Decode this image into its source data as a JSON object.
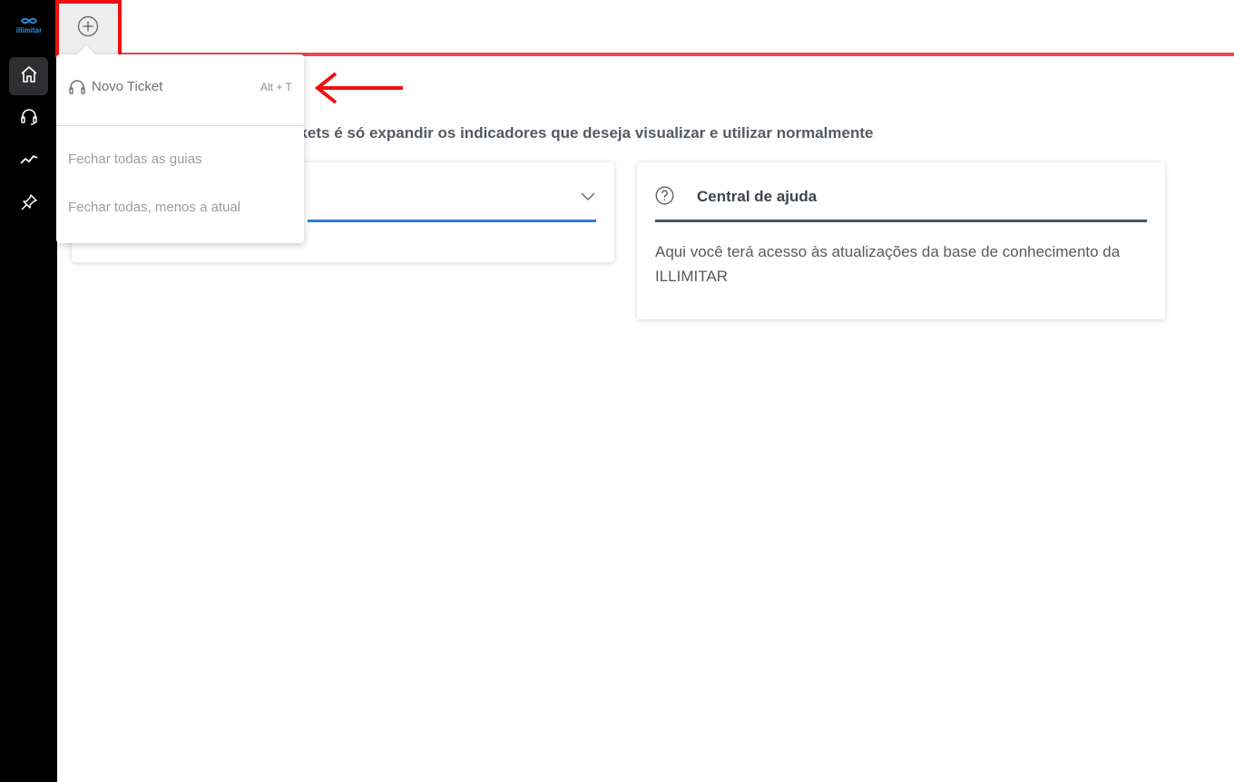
{
  "sidebar": {
    "logo_text": "illimitar",
    "items": [
      {
        "name": "home-icon",
        "active": true
      },
      {
        "name": "headset-icon",
        "active": false
      },
      {
        "name": "trend-chart-icon",
        "active": false
      },
      {
        "name": "pin-icon",
        "active": false
      }
    ]
  },
  "tabs": {
    "add_tab_icon": "plus-circle-icon"
  },
  "main": {
    "subtitle": "ckets é só expandir os indicadores que deseja visualizar e utilizar normalmente",
    "help_card": {
      "title": "Central de ajuda",
      "body": "Aqui você terá acesso às atualizações da base de conhecimento da ILLIMITAR"
    }
  },
  "dropdown": {
    "new_ticket_label": "Novo Ticket",
    "new_ticket_shortcut": "Alt + T",
    "close_all_label": "Fechar todas as guias",
    "close_others_label": "Fechar todas, menos a atual"
  },
  "colors": {
    "sidebar_bg": "#000000",
    "accent_red": "#e84a4f",
    "highlight_red": "#ee1010",
    "accent_blue": "#2f7dd1"
  }
}
